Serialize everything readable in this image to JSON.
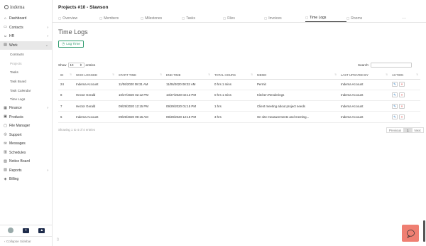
{
  "app": {
    "logo_text": "indema"
  },
  "sidebar": {
    "items": [
      {
        "label": "Dashboard",
        "icon": "home-icon",
        "glyph": "⌂"
      },
      {
        "label": "Contacts",
        "icon": "contacts-icon",
        "glyph": "▭"
      },
      {
        "label": "HR",
        "icon": "hr-icon",
        "glyph": "☺"
      },
      {
        "label": "Work",
        "icon": "work-icon",
        "glyph": "▤"
      }
    ],
    "work_sub": [
      "Contracts",
      "Projects",
      "Tasks",
      "Task Board",
      "Task Calendar",
      "Time Logs"
    ],
    "items2": [
      {
        "label": "Finance",
        "icon": "finance-icon",
        "glyph": "▦"
      },
      {
        "label": "Products",
        "icon": "products-icon",
        "glyph": "▣"
      },
      {
        "label": "File Manager",
        "icon": "folder-icon",
        "glyph": "▢"
      },
      {
        "label": "Support",
        "icon": "support-icon",
        "glyph": "◎"
      },
      {
        "label": "Messages",
        "icon": "messages-icon",
        "glyph": "✉"
      },
      {
        "label": "Schedules",
        "icon": "schedules-icon",
        "glyph": "▥"
      },
      {
        "label": "Notice Board",
        "icon": "notice-icon",
        "glyph": "▧"
      },
      {
        "label": "Reports",
        "icon": "reports-icon",
        "glyph": "▨"
      },
      {
        "label": "Billing",
        "icon": "billing-icon",
        "glyph": "◈"
      }
    ],
    "collapse_label": "Collapse Sidebar"
  },
  "header": {
    "title": "Projects #10 - Slawson"
  },
  "tabs": [
    {
      "label": "Overview",
      "icon": "overview-icon"
    },
    {
      "label": "Members",
      "icon": "members-icon"
    },
    {
      "label": "Milestones",
      "icon": "milestones-icon"
    },
    {
      "label": "Tasks",
      "icon": "tasks-icon"
    },
    {
      "label": "Files",
      "icon": "files-icon"
    },
    {
      "label": "Invoices",
      "icon": "invoices-icon"
    },
    {
      "label": "Time Logs",
      "icon": "time-logs-icon"
    },
    {
      "label": "Rooms",
      "icon": "rooms-icon"
    }
  ],
  "tab_more": "···",
  "page": {
    "heading": "Time Logs",
    "log_time_label": "Log Time",
    "show_label": "Show",
    "show_value": "10",
    "entries_label": "entries",
    "search_label": "Search:",
    "info": "Showing 1 to 4 of 4 entries",
    "prev_label": "Previous",
    "page_num": "1",
    "next_label": "Next"
  },
  "table": {
    "headers": [
      "ID",
      "WHO LOGGED",
      "START TIME",
      "END TIME",
      "TOTAL HOURS",
      "MEMO",
      "LAST UPDATED BY",
      "ACTION"
    ],
    "rows": [
      [
        "24",
        "Indema Account",
        "11/06/2020 08:31 AM",
        "11/06/2020 08:32 AM",
        "0 hrs 1 mins",
        "Permit",
        "Indema Account"
      ],
      [
        "8",
        "Hector Gerald",
        "10/27/2020 02:12 PM",
        "10/27/2020 02:13 PM",
        "0 hrs 1 mins",
        "Kitchen Renderings",
        "Indema Account"
      ],
      [
        "7",
        "Hector Gerald",
        "09/29/2020 12:15 PM",
        "09/29/2020 01:15 PM",
        "1 hrs",
        "Client meeting about project needs",
        "Indema Account"
      ],
      [
        "6",
        "Indema Account",
        "09/29/2020 09:15 AM",
        "09/29/2020 12:15 PM",
        "3 hrs",
        "On site measurements and meeting...",
        "Indema Account"
      ]
    ]
  },
  "colors": {
    "accent_green": "#2e9b6e",
    "chat_button": "#ef7f72",
    "nav_dark": "#1d2b4a"
  }
}
